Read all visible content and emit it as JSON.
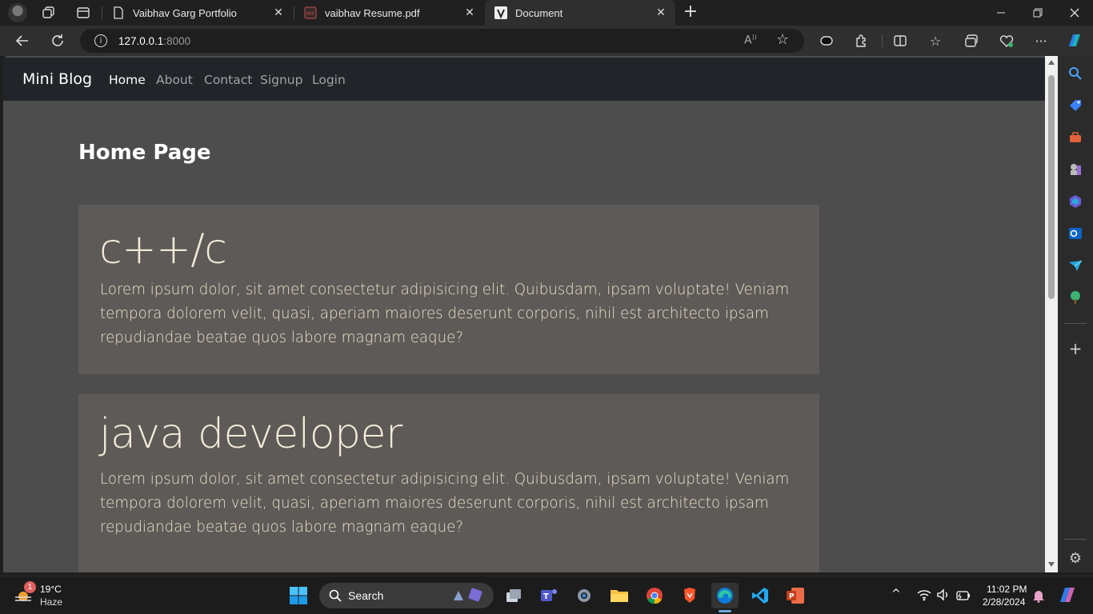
{
  "tabs": [
    {
      "label": "Vaibhav Garg Portfolio"
    },
    {
      "label": "vaibhav Resume.pdf"
    },
    {
      "label": "Document"
    }
  ],
  "address": {
    "host": "127.0.0.1",
    "port": ":8000"
  },
  "site": {
    "brand": "Mini Blog",
    "nav": [
      "Home",
      "About",
      "Contact",
      "Signup",
      "Login"
    ],
    "page_title": "Home Page",
    "posts": [
      {
        "title": "c++/c",
        "body": "Lorem ipsum dolor, sit amet consectetur adipisicing elit. Quibusdam, ipsam voluptate! Veniam tempora dolorem velit, quasi, aperiam maiores deserunt corporis, nihil est architecto ipsam repudiandae beatae quos labore magnam eaque?"
      },
      {
        "title": "java developer",
        "body": "Lorem ipsum dolor, sit amet consectetur adipisicing elit. Quibusdam, ipsam voluptate! Veniam tempora dolorem velit, quasi, aperiam maiores deserunt corporis, nihil est architecto ipsam repudiandae beatae quos labore magnam eaque?"
      }
    ]
  },
  "taskbar": {
    "weather_temp": "19°C",
    "weather_desc": "Haze",
    "weather_badge": "1",
    "search_label": "Search",
    "time": "11:02 PM",
    "date": "2/28/2024"
  },
  "colors": {
    "navbar": "#212529",
    "page_bg": "#4d4d4d",
    "card_bg": "#5d5a57",
    "card_text": "#eee2cc"
  }
}
